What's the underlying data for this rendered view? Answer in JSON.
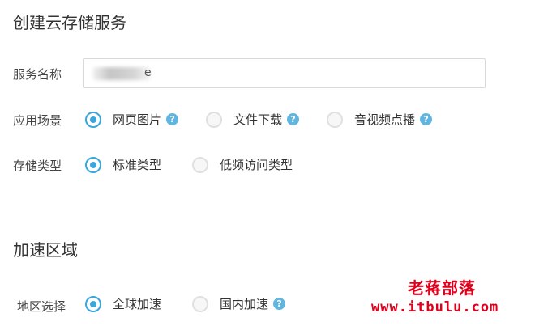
{
  "create_section": {
    "title": "创建云存储服务",
    "service_name": {
      "label": "服务名称",
      "value": "e"
    },
    "scenario": {
      "label": "应用场景",
      "options": [
        {
          "label": "网页图片",
          "checked": true,
          "help": "?"
        },
        {
          "label": "文件下载",
          "checked": false,
          "help": "?"
        },
        {
          "label": "音视频点播",
          "checked": false,
          "help": "?"
        }
      ]
    },
    "storage_type": {
      "label": "存储类型",
      "options": [
        {
          "label": "标准类型",
          "checked": true
        },
        {
          "label": "低频访问类型",
          "checked": false
        }
      ]
    }
  },
  "accel_section": {
    "title": "加速区域",
    "region": {
      "label": "地区选择",
      "options": [
        {
          "label": "全球加速",
          "checked": true
        },
        {
          "label": "国内加速",
          "checked": false,
          "help": "?"
        }
      ]
    }
  },
  "watermark": {
    "name": "老蒋部落",
    "url": "www.itbulu.com"
  },
  "colors": {
    "accent": "#3aa6dc",
    "help_icon": "#5fb6e0",
    "watermark": "#e0001b"
  }
}
